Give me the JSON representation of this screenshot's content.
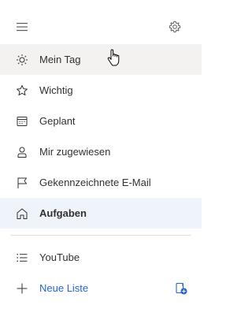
{
  "nav": {
    "items": [
      {
        "label": "Mein Tag",
        "icon": "sun-icon"
      },
      {
        "label": "Wichtig",
        "icon": "star-icon"
      },
      {
        "label": "Geplant",
        "icon": "calendar-icon"
      },
      {
        "label": "Mir zugewiesen",
        "icon": "person-icon"
      },
      {
        "label": "Gekennzeichnete E-Mail",
        "icon": "flag-icon"
      },
      {
        "label": "Aufgaben",
        "icon": "home-icon"
      }
    ],
    "hovered_index": 0,
    "selected_index": 5
  },
  "lists": [
    {
      "label": "YouTube",
      "icon": "list-icon"
    }
  ],
  "new_list": {
    "label": "Neue Liste",
    "icon": "plus-icon",
    "group_icon": "add-group-icon"
  },
  "colors": {
    "accent": "#2564cf",
    "selected_bg": "#eff4fb",
    "hover_bg": "#f3f2f1"
  }
}
